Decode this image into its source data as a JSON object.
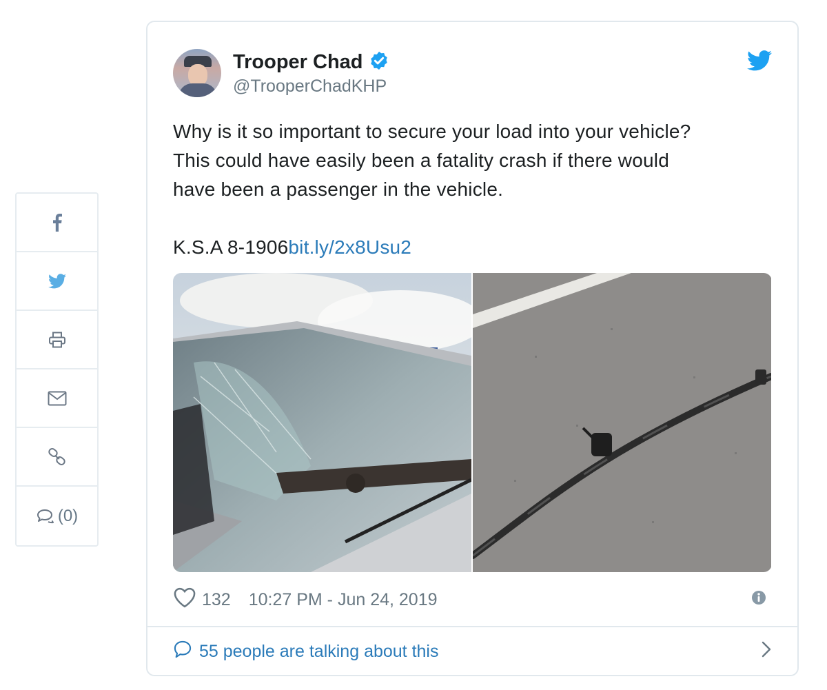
{
  "share": {
    "comment_count": "(0)"
  },
  "tweet": {
    "display_name": "Trooper Chad",
    "handle": "@TrooperChadKHP",
    "text_line1": "Why is it so important to secure your load into your vehicle?",
    "text_line2": "This could have easily been a fatality crash if there would",
    "text_line3": "have been a passenger in the vehicle.",
    "statute": "K.S.A 8-1906",
    "link": "bit.ly/2x8Usu2",
    "like_count": "132",
    "timestamp": "10:27 PM - Jun 24, 2019",
    "talking": "55 people are talking about this"
  },
  "colors": {
    "twitter_blue": "#1da1f2",
    "link_blue": "#2b7bb9",
    "verified_blue": "#1da1f2",
    "muted_gray": "#697882",
    "border": "#e1e8ed"
  },
  "icons": {
    "share": [
      "facebook-icon",
      "twitter-icon",
      "print-icon",
      "email-icon",
      "link-icon",
      "comment-icon"
    ],
    "tweet": [
      "verified-badge-icon",
      "twitter-bird-icon",
      "heart-icon",
      "info-icon",
      "speech-bubble-icon",
      "chevron-right-icon"
    ]
  }
}
